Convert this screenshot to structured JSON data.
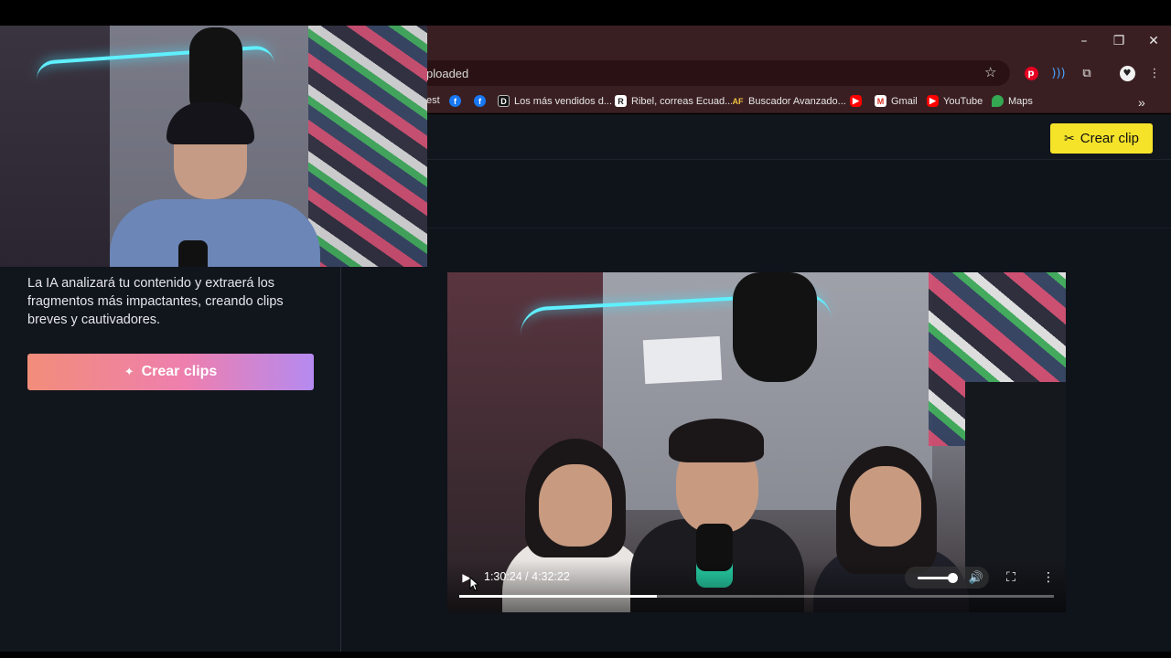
{
  "browser": {
    "address_text": "ploaded",
    "bookmarks": [
      {
        "label": "est",
        "icon": "folder-fragment"
      },
      {
        "label": "",
        "icon": "facebook-icon"
      },
      {
        "label": "",
        "icon": "facebook-icon"
      },
      {
        "label": "Los más vendidos d...",
        "icon": "d-logo-icon"
      },
      {
        "label": "Ribel, correas Ecuad...",
        "icon": "r-logo-icon"
      },
      {
        "label": "Buscador Avanzado...",
        "icon": "af-logo-icon"
      },
      {
        "label": "",
        "icon": "youtube-icon"
      },
      {
        "label": "Gmail",
        "icon": "gmail-icon"
      },
      {
        "label": "YouTube",
        "icon": "youtube-icon"
      },
      {
        "label": "Maps",
        "icon": "maps-icon"
      }
    ],
    "overflow_label": "»"
  },
  "header": {
    "crear_clip_label": "Crear clip"
  },
  "panel": {
    "description": "La IA analizará tu contenido y extraerá los fragmentos más impactantes, creando clips breves y cautivadores.",
    "cta_label": "Crear clips"
  },
  "player": {
    "time": "1:30:24 / 4:32:22",
    "progress": 0.333,
    "volume": 0.85
  },
  "colors": {
    "accent_yellow": "#f5e32a",
    "cta_gradient_start": "#f28d7a",
    "cta_gradient_end": "#b58af0",
    "browser_frame": "#3a1f22",
    "page_bg": "#0f131a"
  }
}
